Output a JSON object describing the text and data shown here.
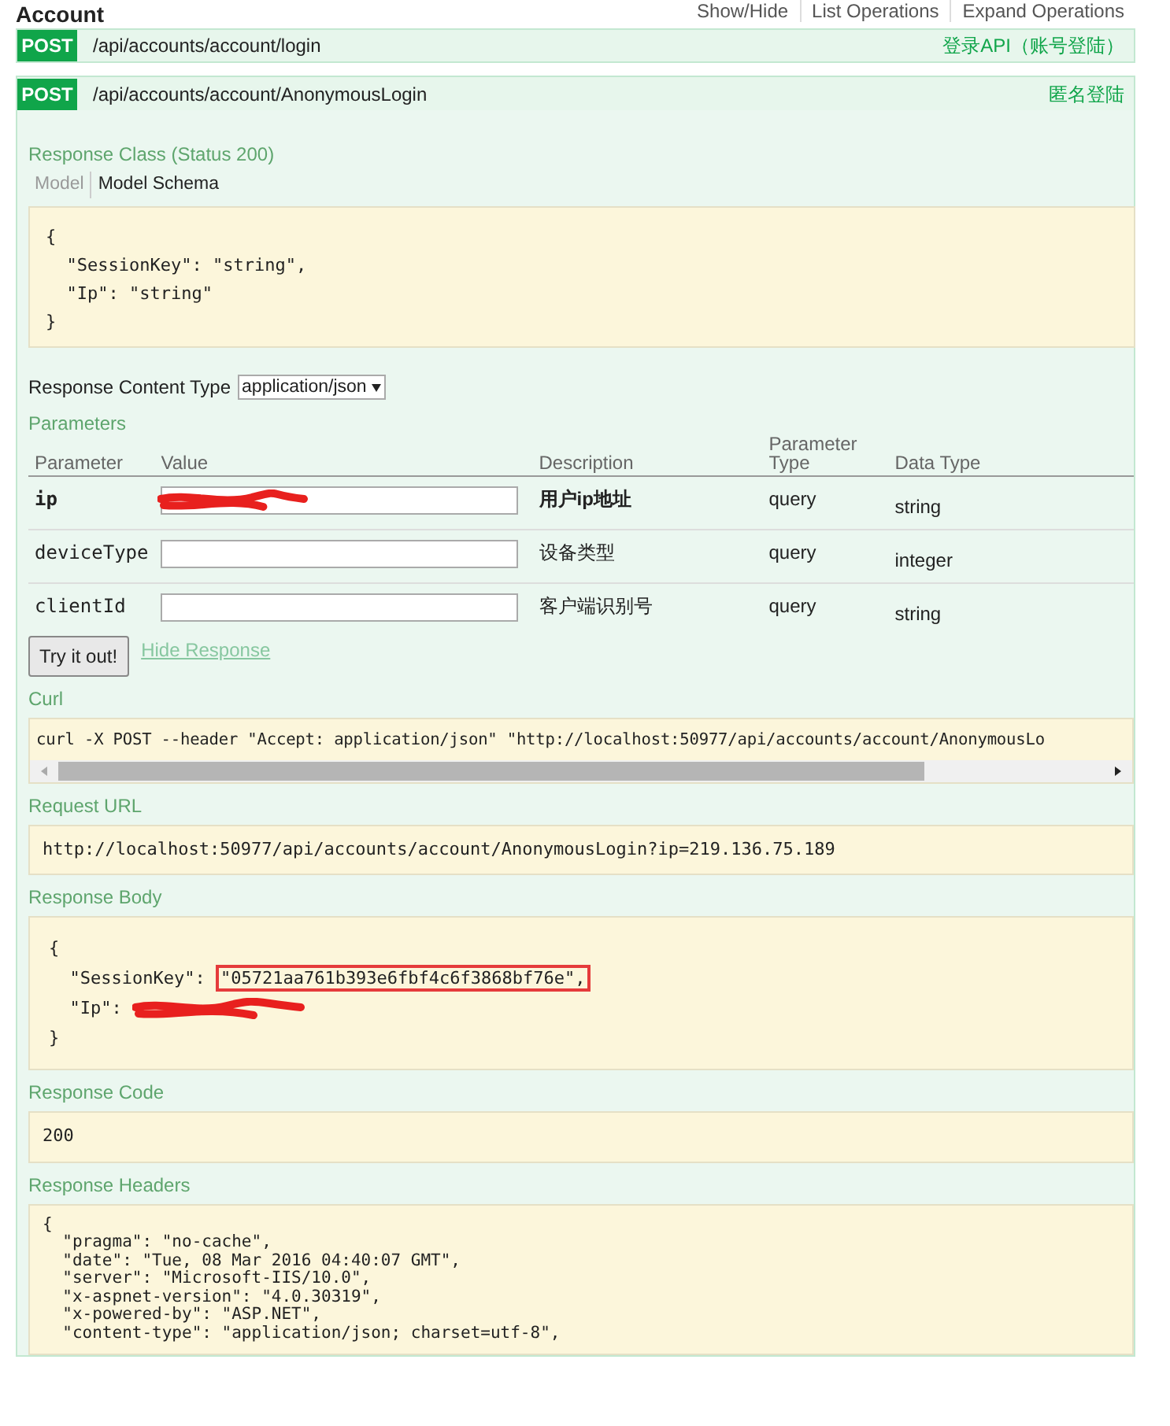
{
  "resource": {
    "title": "Account",
    "links": [
      {
        "label": "Show/Hide"
      },
      {
        "label": "List Operations"
      },
      {
        "label": "Expand Operations"
      }
    ]
  },
  "operations": [
    {
      "method": "POST",
      "path": "/api/accounts/account/login",
      "summary": "登录API（账号登陆）",
      "expanded": false
    },
    {
      "method": "POST",
      "path": "/api/accounts/account/AnonymousLogin",
      "summary": "匿名登陆",
      "expanded": true
    }
  ],
  "details": {
    "response_class_title": "Response Class (Status 200)",
    "model_tabs": [
      {
        "label": "Model",
        "selected": false
      },
      {
        "label": "Model Schema",
        "selected": true
      }
    ],
    "model_schema": [
      "{",
      "  \"SessionKey\": \"string\",",
      "  \"Ip\": \"string\"",
      "}"
    ],
    "content_type_label": "Response Content Type",
    "content_type_value": "application/json",
    "parameters_title": "Parameters",
    "parameter_columns": [
      "Parameter",
      "Value",
      "Description",
      "Parameter Type",
      "Data Type"
    ],
    "parameters": [
      {
        "name": "ip",
        "required": true,
        "redacted": true,
        "description": "用户ip地址",
        "param_type": "query",
        "data_type": "string"
      },
      {
        "name": "deviceType",
        "required": false,
        "redacted": false,
        "description": "设备类型",
        "param_type": "query",
        "data_type": "integer"
      },
      {
        "name": "clientId",
        "required": false,
        "redacted": false,
        "description": "客户端识别号",
        "param_type": "query",
        "data_type": "string"
      }
    ],
    "try_button": "Try it out!",
    "hide_link": "Hide Response",
    "curl_title": "Curl",
    "curl": "curl -X POST --header \"Accept: application/json\" \"http://localhost:50977/api/accounts/account/AnonymousLo",
    "request_url_title": "Request URL",
    "request_url": "http://localhost:50977/api/accounts/account/AnonymousLogin?ip=219.136.75.189",
    "response_body_title": "Response Body",
    "response_body": [
      {
        "parts": [
          {
            "kind": "text",
            "text": "{",
            "boxed": false
          }
        ]
      },
      {
        "parts": [
          {
            "kind": "text",
            "text": "  \"SessionKey\": ",
            "boxed": false
          },
          {
            "kind": "text",
            "text": "\"05721aa761b393e6fbf4c6f3868bf76e\",",
            "boxed": true
          }
        ]
      },
      {
        "parts": [
          {
            "kind": "text",
            "text": "  \"Ip\": ",
            "boxed": false
          },
          {
            "kind": "redaction"
          }
        ]
      },
      {
        "parts": [
          {
            "kind": "text",
            "text": "}",
            "boxed": false
          }
        ]
      }
    ],
    "response_code_title": "Response Code",
    "response_code": "200",
    "response_headers_title": "Response Headers",
    "response_headers": [
      "{",
      "  \"pragma\": \"no-cache\",",
      "  \"date\": \"Tue, 08 Mar 2016 04:40:07 GMT\",",
      "  \"server\": \"Microsoft-IIS/10.0\",",
      "  \"x-aspnet-version\": \"4.0.30319\",",
      "  \"x-powered-by\": \"ASP.NET\",",
      "  \"content-type\": \"application/json; charset=utf-8\","
    ]
  }
}
